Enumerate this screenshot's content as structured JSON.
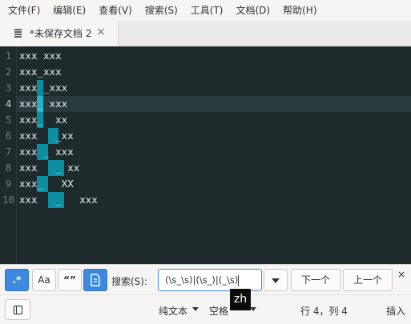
{
  "menubar": {
    "items": [
      "文件(F)",
      "编辑(E)",
      "查看(V)",
      "搜索(S)",
      "工具(T)",
      "文档(D)",
      "帮助(H)"
    ]
  },
  "tab": {
    "title": "*未保存文档 2",
    "close": "×",
    "icon": "document-text-icon"
  },
  "editor": {
    "theme": "dark",
    "current_line": 4,
    "lines": [
      {
        "number": "1",
        "text": "xxx xxx"
      },
      {
        "number": "2",
        "text": "xxx_xxx"
      },
      {
        "number": "3",
        "text": "xxx _xxx"
      },
      {
        "number": "4",
        "text": "xxx_ xxx"
      },
      {
        "number": "5",
        "text": "xxx_  xx"
      },
      {
        "number": "6",
        "text": "xxx   _xx"
      },
      {
        "number": "7",
        "text": "xxx _ xxx"
      },
      {
        "number": "8",
        "text": "xxx   _ xx"
      },
      {
        "number": "9",
        "text": "xxx_   XX"
      },
      {
        "number": "10",
        "text": "xxx   _   xxx"
      }
    ],
    "colors": {
      "background": "#1e2a2c",
      "match": "#0b8ea0",
      "current_match": "#22b2c4"
    }
  },
  "search": {
    "regex_icon": "regex-icon",
    "regex_label": ".*",
    "case_label": "Aa",
    "quote_label": "“”",
    "in_selection_icon": "selection-icon",
    "label": "搜索(S):",
    "query": "(\\s_\\s)|(\\s_)|(_\\s)",
    "history_icon": "chevron-down-icon",
    "next": "下一个",
    "previous": "上一个",
    "close": "×"
  },
  "statusbar": {
    "sidebar_icon": "side-panel-icon",
    "language": "纯文本",
    "indent": "空格",
    "position": "行 4，列 4",
    "mode": "插入"
  },
  "ime": {
    "label": "zh"
  }
}
